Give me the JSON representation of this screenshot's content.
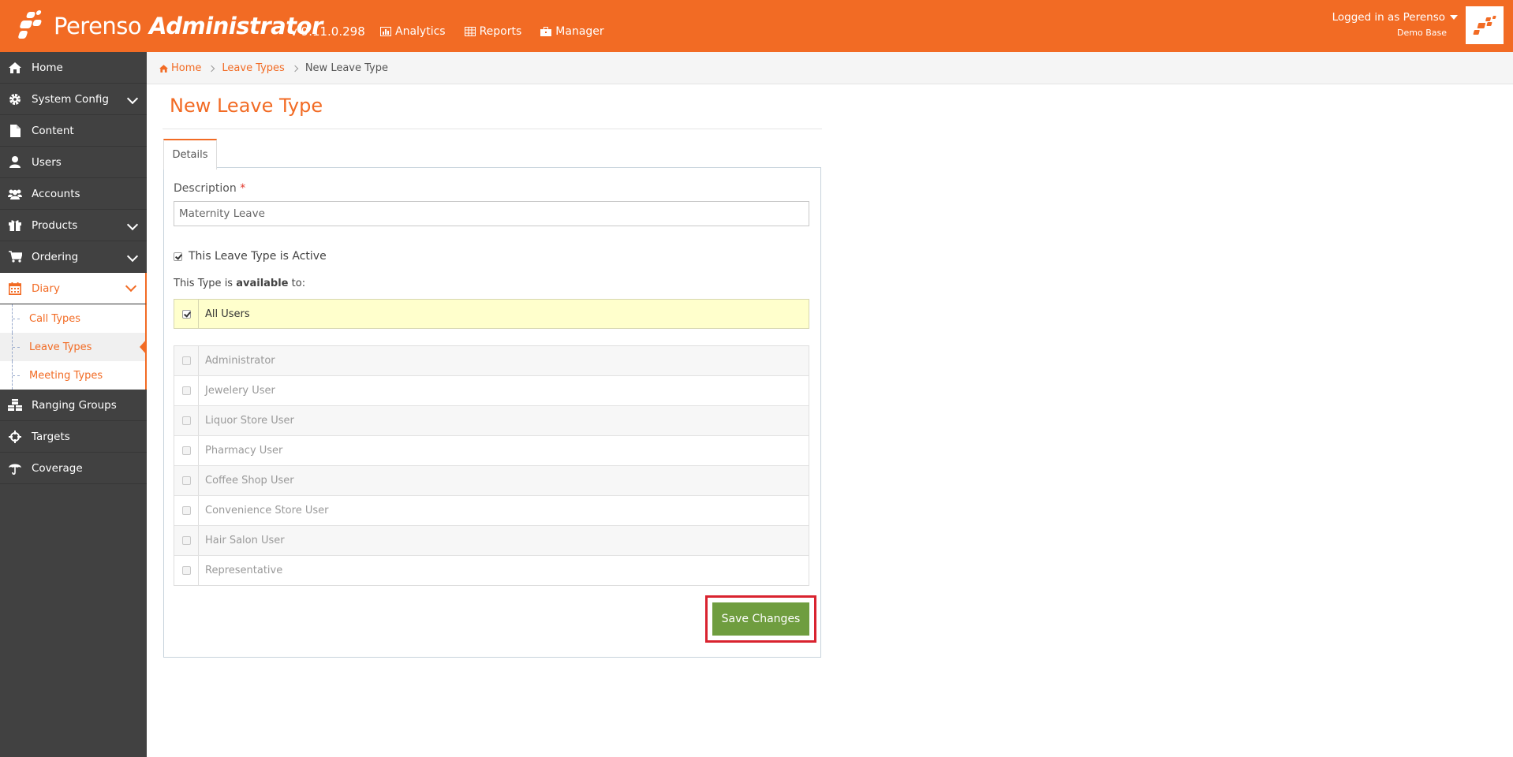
{
  "app": {
    "brand_name": "Perenso",
    "brand_suffix": "Administrator",
    "version": "v 9.11.0.298",
    "brand_color": "#f26b24"
  },
  "topnav": [
    {
      "label": "Analytics",
      "icon": "bar-chart-icon"
    },
    {
      "label": "Reports",
      "icon": "table-icon"
    },
    {
      "label": "Manager",
      "icon": "briefcase-icon"
    }
  ],
  "user": {
    "logged_in": "Logged in as Perenso",
    "database": "Demo Base"
  },
  "sidebar": {
    "items": [
      {
        "label": "Home",
        "icon": "home-icon"
      },
      {
        "label": "System Config",
        "icon": "gear-icon"
      },
      {
        "label": "Content",
        "icon": "file-icon"
      },
      {
        "label": "Users",
        "icon": "user-icon"
      },
      {
        "label": "Accounts",
        "icon": "users-icon"
      },
      {
        "label": "Products",
        "icon": "gift-icon"
      },
      {
        "label": "Ordering",
        "icon": "cart-icon"
      },
      {
        "label": "Diary",
        "icon": "calendar-icon"
      },
      {
        "label": "Ranging Groups",
        "icon": "cubes-icon"
      },
      {
        "label": "Targets",
        "icon": "crosshair-icon"
      },
      {
        "label": "Coverage",
        "icon": "umbrella-icon"
      }
    ],
    "diary_sub": [
      {
        "label": "Call Types"
      },
      {
        "label": "Leave Types"
      },
      {
        "label": "Meeting Types"
      }
    ]
  },
  "breadcrumb": {
    "home": "Home",
    "parent": "Leave Types",
    "current": "New Leave Type"
  },
  "page": {
    "title": "New Leave Type",
    "tab": "Details"
  },
  "form": {
    "description_label": "Description",
    "required_mark": "*",
    "description_value": "Maternity Leave",
    "active_label": "This Leave Type is Active",
    "active_checked": true,
    "available_prefix": "This Type is ",
    "available_bold": "available",
    "available_suffix": " to:",
    "all_users_label": "All Users",
    "all_users_checked": true,
    "roles": [
      "Administrator",
      "Jewelery User",
      "Liquor Store User",
      "Pharmacy User",
      "Coffee Shop User",
      "Convenience Store User",
      "Hair Salon User",
      "Representative"
    ],
    "save_label": "Save Changes"
  }
}
